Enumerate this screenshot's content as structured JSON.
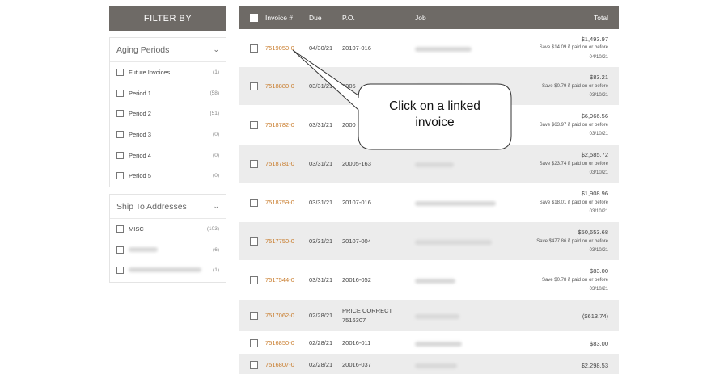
{
  "sidebar": {
    "header": "FILTER BY",
    "aging": {
      "title": "Aging Periods",
      "items": [
        {
          "label": "Future Invoices",
          "count": "(1)"
        },
        {
          "label": "Period 1",
          "count": "(58)"
        },
        {
          "label": "Period 2",
          "count": "(51)"
        },
        {
          "label": "Period 3",
          "count": "(0)"
        },
        {
          "label": "Period 4",
          "count": "(0)"
        },
        {
          "label": "Period 5",
          "count": "(0)"
        }
      ]
    },
    "ship": {
      "title": "Ship To Addresses",
      "items": [
        {
          "label": "MISC",
          "count": "(103)"
        },
        {
          "label": "",
          "count": "(6)"
        },
        {
          "label": "",
          "count": "(1)"
        }
      ]
    }
  },
  "table": {
    "headers": {
      "invoice": "Invoice #",
      "due": "Due",
      "po": "P.O.",
      "job": "Job",
      "total": "Total"
    },
    "rows": [
      {
        "invoice": "7519050-0",
        "due": "04/30/21",
        "po": "20107-016",
        "po2": "",
        "amount": "$1,493.97",
        "save1": "Save $14.09 if paid on or before",
        "save2": "04/10/21"
      },
      {
        "invoice": "7518880-0",
        "due": "03/31/21",
        "po": "1905",
        "po2": "",
        "amount": "$83.21",
        "save1": "Save $0.79 if paid on or before",
        "save2": "03/10/21"
      },
      {
        "invoice": "7518782-0",
        "due": "03/31/21",
        "po": "2000",
        "po2": "",
        "amount": "$6,966.56",
        "save1": "Save $63.97 if paid on or before",
        "save2": "03/10/21"
      },
      {
        "invoice": "7518781-0",
        "due": "03/31/21",
        "po": "20005-163",
        "po2": "",
        "amount": "$2,585.72",
        "save1": "Save $23.74 if paid on or before",
        "save2": "03/10/21"
      },
      {
        "invoice": "7518759-0",
        "due": "03/31/21",
        "po": "20107-016",
        "po2": "",
        "amount": "$1,908.96",
        "save1": "Save $18.01 if paid on or before",
        "save2": "03/10/21"
      },
      {
        "invoice": "7517750-0",
        "due": "03/31/21",
        "po": "20107-004",
        "po2": "",
        "amount": "$50,653.68",
        "save1": "Save $477.86 if paid on or before",
        "save2": "03/10/21"
      },
      {
        "invoice": "7517544-0",
        "due": "03/31/21",
        "po": "20016-052",
        "po2": "",
        "amount": "$83.00",
        "save1": "Save $0.78 if paid on or before",
        "save2": "03/10/21"
      },
      {
        "invoice": "7517062-0",
        "due": "02/28/21",
        "po": "PRICE CORRECT",
        "po2": "7516307",
        "amount": "($613.74)",
        "save1": "",
        "save2": ""
      },
      {
        "invoice": "7516850-0",
        "due": "02/28/21",
        "po": "20016-011",
        "po2": "",
        "amount": "$83.00",
        "save1": "",
        "save2": ""
      },
      {
        "invoice": "7516807-0",
        "due": "02/28/21",
        "po": "20016-037",
        "po2": "",
        "amount": "$2,298.53",
        "save1": "",
        "save2": ""
      }
    ]
  },
  "callout": {
    "line1": "Click on a linked",
    "line2": "invoice"
  }
}
